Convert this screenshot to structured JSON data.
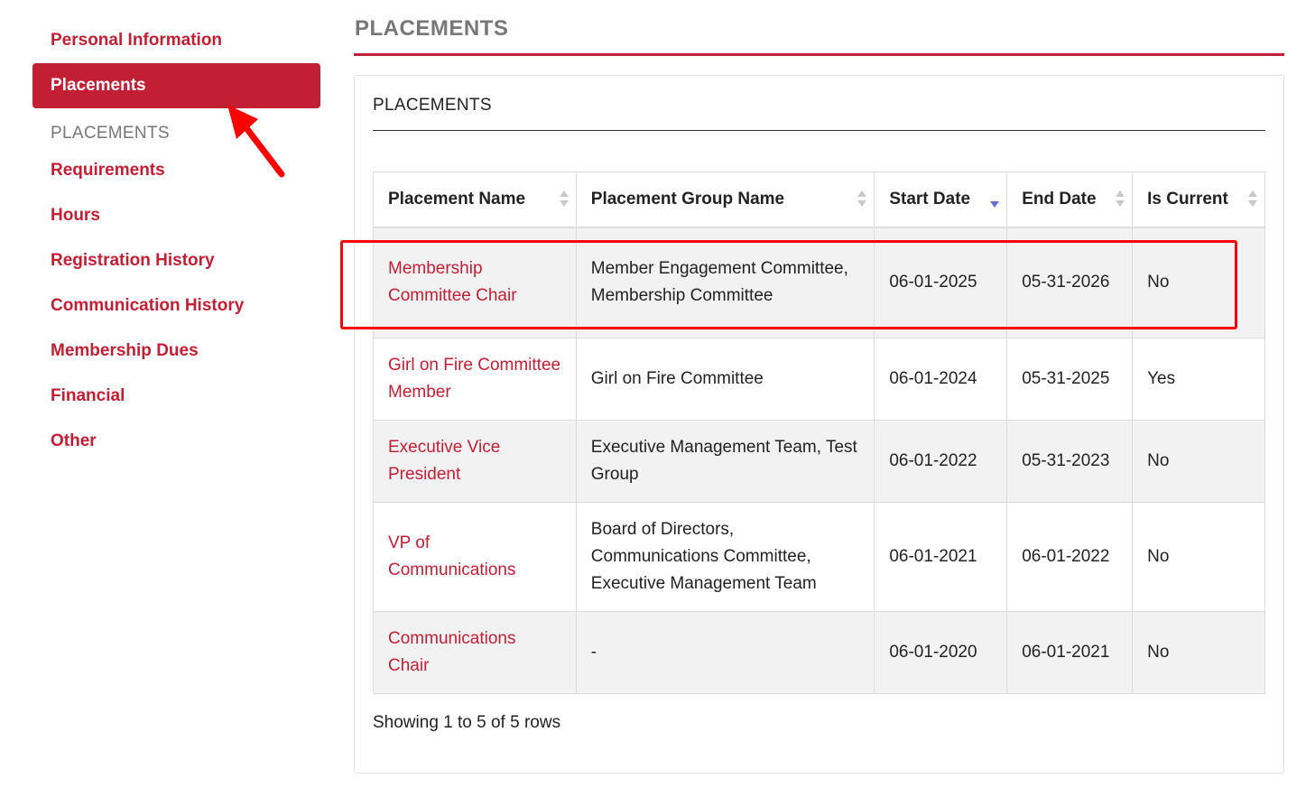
{
  "sidebar": {
    "items": [
      {
        "label": "Personal Information"
      },
      {
        "label": "Placements"
      }
    ],
    "section_label": "PLACEMENTS",
    "sub_items": [
      {
        "label": "Requirements"
      },
      {
        "label": "Hours"
      },
      {
        "label": "Registration History"
      },
      {
        "label": "Communication History"
      },
      {
        "label": "Membership Dues"
      },
      {
        "label": "Financial"
      },
      {
        "label": "Other"
      }
    ]
  },
  "main": {
    "page_title": "PLACEMENTS",
    "panel_title": "PLACEMENTS"
  },
  "table": {
    "columns": [
      "Placement Name",
      "Placement Group Name",
      "Start Date",
      "End Date",
      "Is Current"
    ],
    "sorted_column": "Start Date",
    "sort_direction": "descending",
    "rows": [
      {
        "name": "Membership Committee Chair",
        "group": "Member Engagement Committee, Membership Committee",
        "start": "06-01-2025",
        "end": "05-31-2026",
        "current": "No"
      },
      {
        "name": "Girl on Fire Committee Member",
        "group": "Girl on Fire Committee",
        "start": "06-01-2024",
        "end": "05-31-2025",
        "current": "Yes"
      },
      {
        "name": "Executive Vice President",
        "group": "Executive Management Team, Test Group",
        "start": "06-01-2022",
        "end": "05-31-2023",
        "current": "No"
      },
      {
        "name": "VP of Communications",
        "group": "Board of Directors, Communications Committee, Executive Management Team",
        "start": "06-01-2021",
        "end": "06-01-2022",
        "current": "No"
      },
      {
        "name": "Communications Chair",
        "group": "-",
        "start": "06-01-2020",
        "end": "06-01-2021",
        "current": "No"
      }
    ],
    "footer": "Showing 1 to 5 of 5 rows"
  },
  "colors": {
    "accent": "#c21e34",
    "annotation": "#ff0000"
  },
  "icons": [
    "sort-icon",
    "sort-desc-icon",
    "annotation-arrow-icon"
  ]
}
